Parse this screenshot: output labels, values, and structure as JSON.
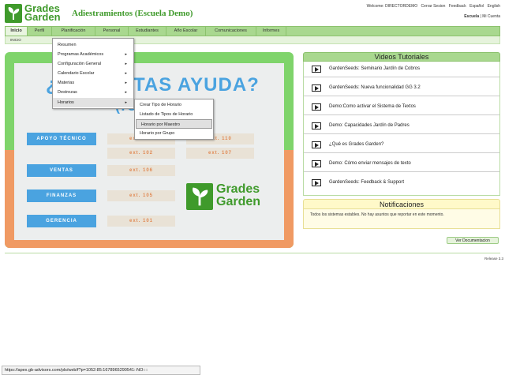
{
  "header": {
    "logo_text_1": "Grades",
    "logo_text_2": "Garden",
    "app_title": "Adiestramientos (Escuela Demo)",
    "welcome": "Welcome: DIRECTORDEMO",
    "links": [
      "Cerrar Sesion",
      "Feedback",
      "Español",
      "English"
    ],
    "context_current": "Escuela",
    "context_sep": "|",
    "context_other": "Mi Cuenta"
  },
  "nav": {
    "items": [
      "Inicio",
      "Perfil",
      "Planificación",
      "Personal",
      "Estudiantes",
      "Año Escolar",
      "Comunicaciones",
      "Informes"
    ],
    "breadcrumb": "INICIO"
  },
  "planificacion_menu": {
    "items": [
      {
        "label": "Resumen",
        "has_sub": false
      },
      {
        "label": "Programas Académicos",
        "has_sub": true
      },
      {
        "label": "Configuración General",
        "has_sub": true
      },
      {
        "label": "Calendario Escolar",
        "has_sub": true
      },
      {
        "label": "Materias",
        "has_sub": true
      },
      {
        "label": "Destrezas",
        "has_sub": true
      },
      {
        "label": "Horarios",
        "has_sub": true
      }
    ],
    "arrow": "▸"
  },
  "horarios_submenu": {
    "items": [
      "Crear Tipo de Horario",
      "Listado de Tipos de Horario",
      "Horario por Maestro",
      "Horario por Grupo"
    ]
  },
  "banner": {
    "question": "¿NECESITAS AYUDA?",
    "phone": "(787)",
    "departments": [
      "APOYO TÉCNICO",
      "VENTAS",
      "FINANZAS",
      "GERENCIA"
    ],
    "ext_row1": [
      "ext. 103",
      "ext. 110"
    ],
    "ext_row2": [
      "ext. 102",
      "ext. 107"
    ],
    "ext_ventas": "ext. 106",
    "ext_finanzas": "ext. 105",
    "ext_gerencia": "ext. 101",
    "logo_text_1": "Grades",
    "logo_text_2": "Garden"
  },
  "videos": {
    "title": "Videos Tutoriales",
    "items": [
      "GardenSeeds: Seminario Jardín de Cobros",
      "GardenSeeds: Nueva funcionalidad GG 3.2",
      "Demo:Como activar el Sistema de Textos",
      "Demo: Capacidades Jardín de Padres",
      "¿Qué es Grades Garden?",
      "Demo: Cómo enviar mensajes de texto",
      "GardenSeeds: Feedback & Support"
    ]
  },
  "notifications": {
    "title": "Notificaciones",
    "message": "Todos los sistemas estables. No hay asuntos que reportar en este momento."
  },
  "doc_button": "Ver Documentacion",
  "release": "Release 3.3",
  "status_url": "https://apex.gb-advisors.com/pls/web/f?p=1052:85:1678965290541::NO::::",
  "colors": {
    "brand_green": "#3f9a2b",
    "nav_green": "#a9d88f",
    "accent_blue": "#4aa3e0",
    "accent_orange": "#f09a63"
  }
}
